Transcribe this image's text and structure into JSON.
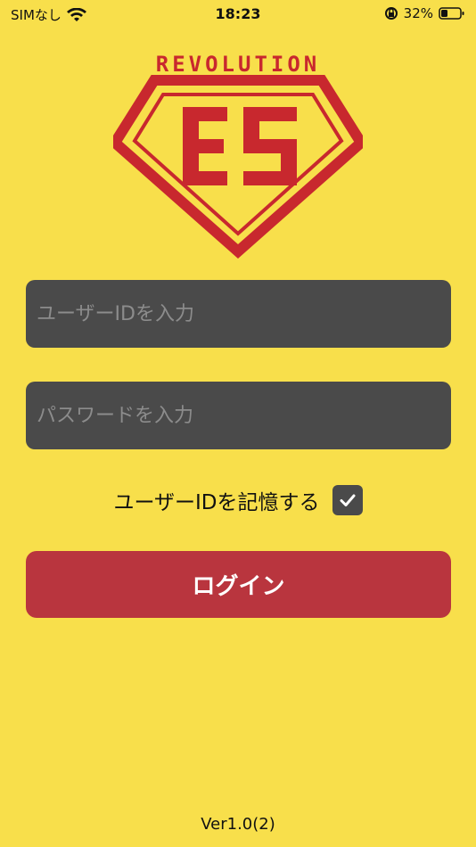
{
  "status_bar": {
    "carrier": "SIMなし",
    "time": "18:23",
    "battery": "32%",
    "wifi_icon": "wifi-icon",
    "rotation_lock_icon": "rotation-lock-icon",
    "battery_icon": "battery-icon"
  },
  "logo": {
    "top_text": "REVOLUTION",
    "emblem_text": "ES",
    "color": "#c8282e"
  },
  "form": {
    "user_id_placeholder": "ユーザーIDを入力",
    "password_placeholder": "パスワードを入力",
    "remember_label": "ユーザーIDを記憶する",
    "remember_checked": true,
    "login_label": "ログイン"
  },
  "footer": {
    "version": "Ver1.0(2)"
  },
  "colors": {
    "background": "#f8df4b",
    "field": "#4a4a4a",
    "button": "#b9353e"
  }
}
